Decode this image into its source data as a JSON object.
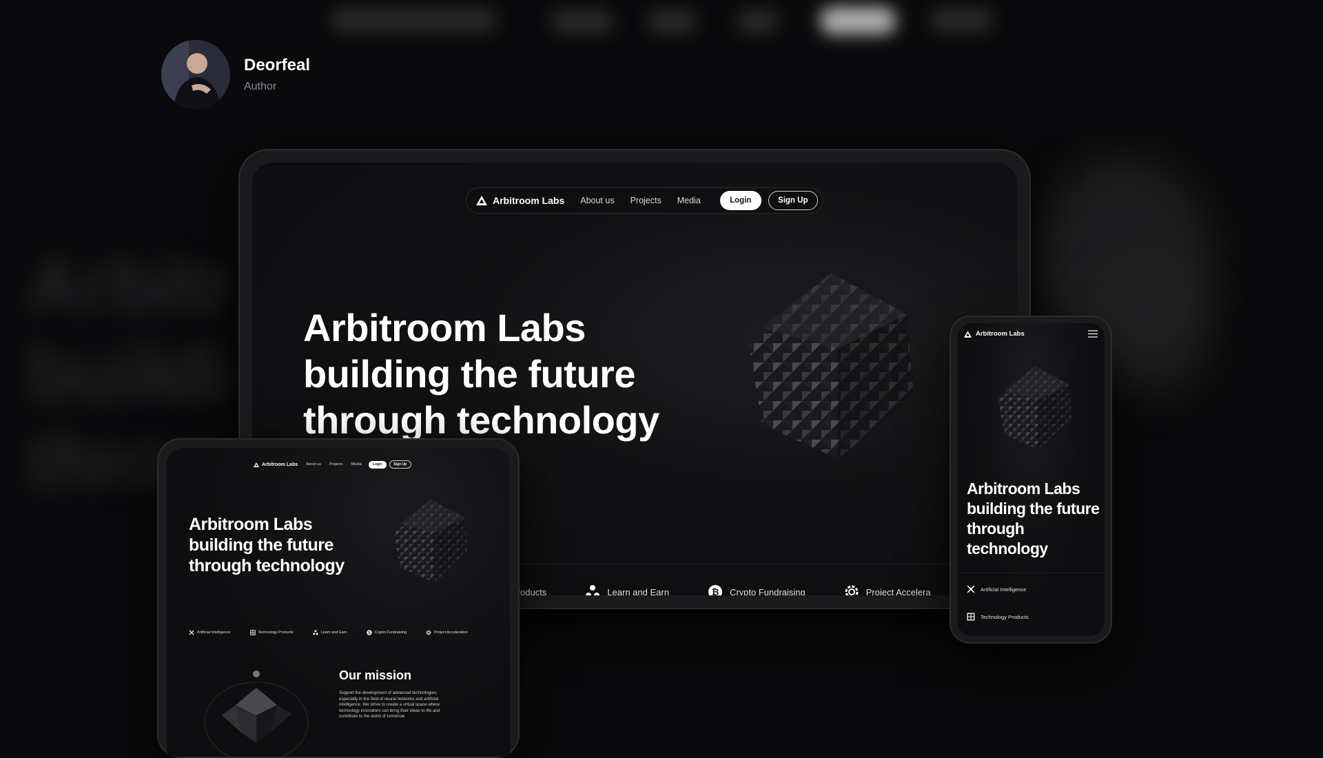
{
  "author": {
    "name": "Deorfeal",
    "role": "Author"
  },
  "site": {
    "brand": "Arbitroom Labs",
    "nav": {
      "about": "About us",
      "projects": "Projects",
      "media": "Media",
      "login": "Login",
      "signup": "Sign Up"
    },
    "hero": {
      "title": "Arbitroom Labs building the future through technology"
    },
    "features": [
      {
        "label": "Artificial Intelligence",
        "icon": "ai-icon"
      },
      {
        "label": "Technology Products",
        "icon": "grid-icon"
      },
      {
        "label": "Learn and Earn",
        "icon": "network-icon"
      },
      {
        "label": "Crypto Fundraising",
        "icon": "bitcoin-icon"
      },
      {
        "label": "Project Acceleration",
        "icon": "gear-icon"
      }
    ],
    "laptop_features": {
      "products": "Products",
      "learn": "Learn and Earn",
      "crypto": "Crypto Fundraising",
      "accel": "Project Accelera"
    },
    "mission": {
      "title": "Our mission",
      "text": "Support the development of advanced technologies, especially in the field of neural networks and artificial intelligence. We strive to create a virtual space where technology innovators can bring their ideas to life and contribute to the world of tomorrow"
    }
  },
  "colors": {
    "background": "#0a0a0c",
    "accent": "#ffffff",
    "muted": "#8a8a8e"
  }
}
